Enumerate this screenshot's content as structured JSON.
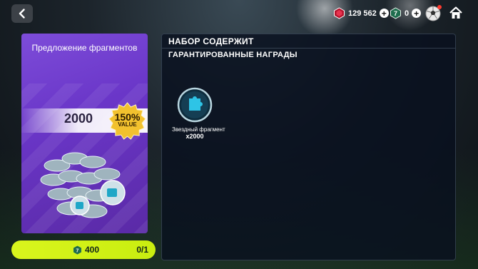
{
  "topbar": {
    "gems": "129 562",
    "tokens": "0"
  },
  "offer": {
    "title": "Предложение фрагментов",
    "amount": "2000",
    "value_percent": "150%",
    "value_label": "VALUE"
  },
  "buy": {
    "price": "400",
    "count": "0/1"
  },
  "panel": {
    "title": "НАБОР СОДЕРЖИТ",
    "subtitle": "ГАРАНТИРОВАННЫЕ НАГРАДЫ",
    "rewards": [
      {
        "name": "Звездный фрагмент",
        "qty": "x2000",
        "icon": "puzzle-piece-icon"
      }
    ]
  },
  "colors": {
    "accent": "#d9f51d",
    "offer_purple": "#6a36c8",
    "panel_bg": "#08101e"
  }
}
